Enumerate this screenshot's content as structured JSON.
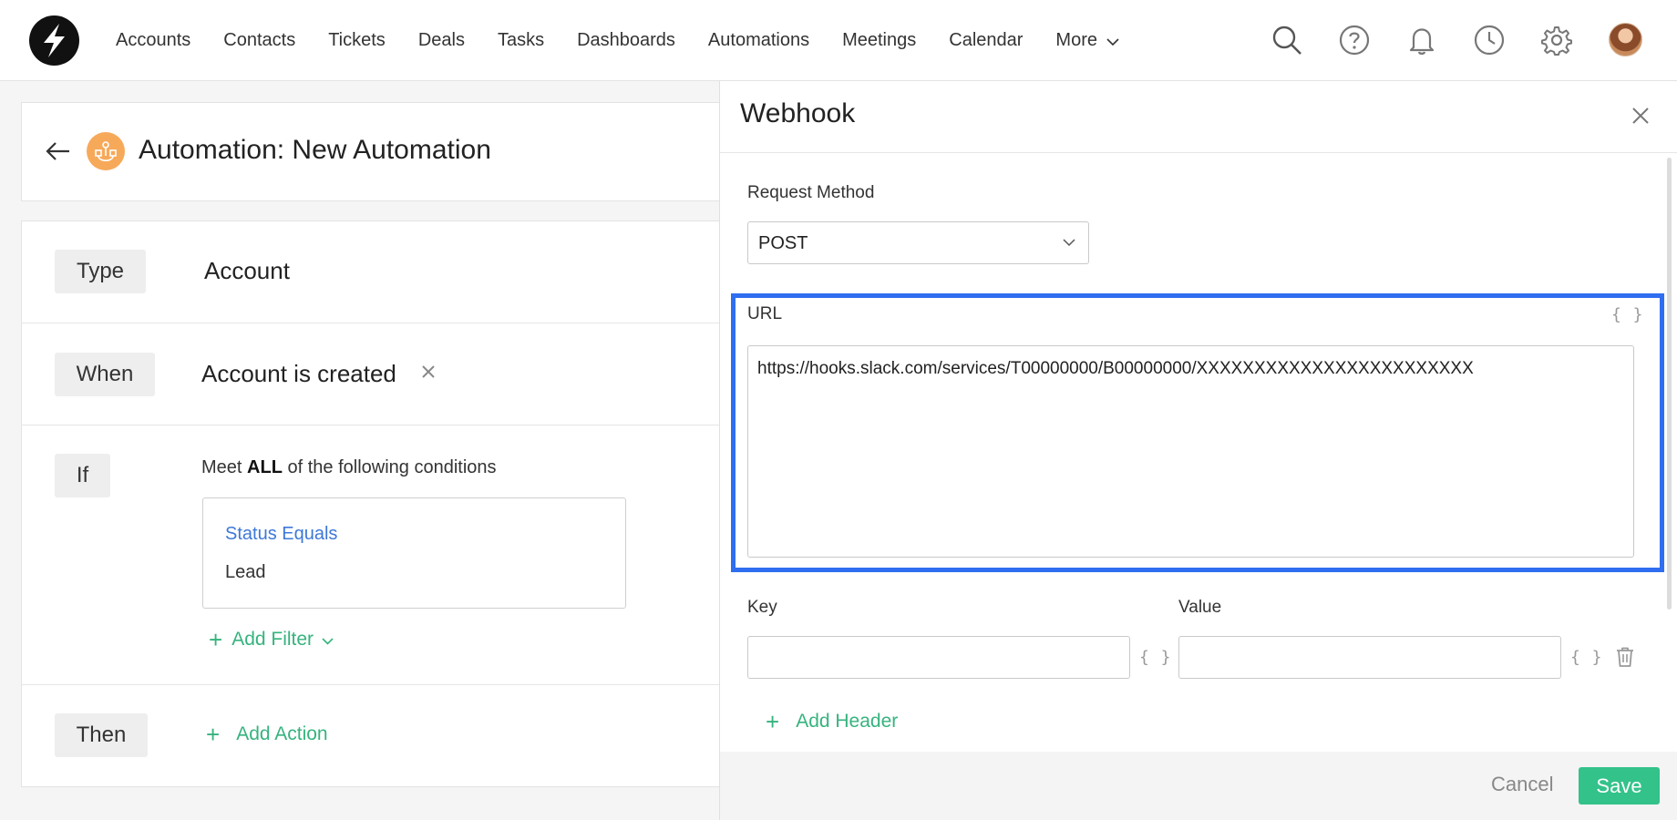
{
  "nav": {
    "items": [
      "Accounts",
      "Contacts",
      "Tickets",
      "Deals",
      "Tasks",
      "Dashboards",
      "Automations",
      "Meetings",
      "Calendar"
    ],
    "more_label": "More"
  },
  "icons": {
    "logo": "lightning-bolt-icon",
    "search": "search-icon",
    "help": "question-circle-icon",
    "notifications": "bell-icon",
    "history": "clock-icon",
    "settings": "gear-icon"
  },
  "automation": {
    "title": "Automation: New Automation",
    "type_label": "Type",
    "type_value": "Account",
    "when_label": "When",
    "when_value": "Account is created",
    "if_label": "If",
    "meet_prefix": "Meet ",
    "meet_all": "ALL",
    "meet_suffix": " of the following conditions",
    "condition_title": "Status Equals",
    "condition_value": "Lead",
    "add_filter_label": "Add Filter",
    "then_label": "Then",
    "add_action_label": "Add Action"
  },
  "webhook": {
    "title": "Webhook",
    "request_method_label": "Request Method",
    "request_method_value": "POST",
    "url_label": "URL",
    "url_value": "https://hooks.slack.com/services/T00000000/B00000000/XXXXXXXXXXXXXXXXXXXXXXXX",
    "braces": "{ }",
    "key_label": "Key",
    "value_label": "Value",
    "add_header_label": "Add Header",
    "cancel_label": "Cancel",
    "save_label": "Save"
  },
  "colors": {
    "accent_green": "#36b37e",
    "save_green": "#33c28a",
    "highlight_blue": "#2f6ef0",
    "link_blue": "#3d78d8",
    "automation_badge": "#f7a95a"
  }
}
